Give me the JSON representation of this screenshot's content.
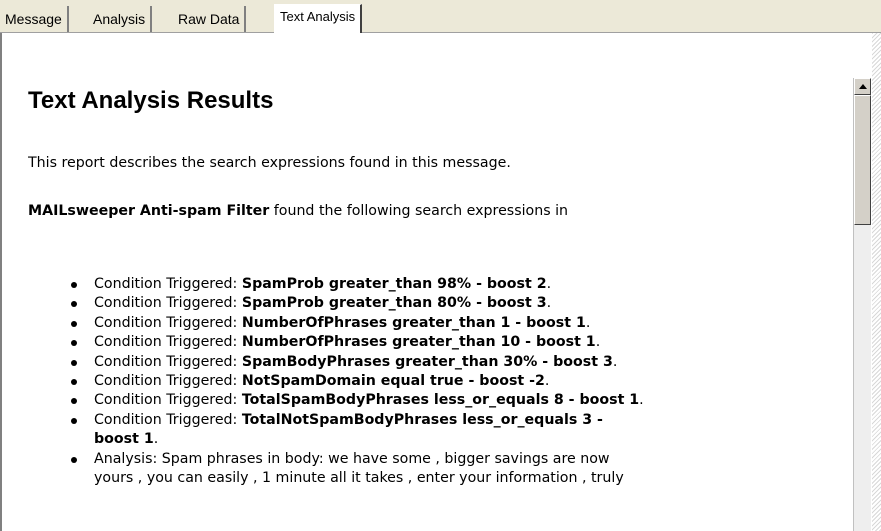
{
  "tabs": [
    {
      "label": "Message",
      "active": false
    },
    {
      "label": "Analysis",
      "active": false
    },
    {
      "label": "Raw Data",
      "active": false
    },
    {
      "label": "Text Analysis",
      "active": true
    }
  ],
  "report": {
    "title": "Text Analysis Results",
    "intro": "This report describes the search expressions found in this message.",
    "filter_name": "MAILsweeper Anti-spam Filter",
    "found_text": " found the following search expressions in",
    "items": [
      {
        "label": "Condition Triggered: ",
        "expression": "SpamProb greater_than 98% - boost 2",
        "end": "."
      },
      {
        "label": "Condition Triggered: ",
        "expression": "SpamProb greater_than 80% - boost 3",
        "end": "."
      },
      {
        "label": "Condition Triggered: ",
        "expression": "NumberOfPhrases greater_than 1 - boost 1",
        "end": "."
      },
      {
        "label": "Condition Triggered: ",
        "expression": "NumberOfPhrases greater_than 10 - boost 1",
        "end": "."
      },
      {
        "label": "Condition Triggered: ",
        "expression": "SpamBodyPhrases greater_than 30% - boost 3",
        "end": "."
      },
      {
        "label": "Condition Triggered: ",
        "expression": "NotSpamDomain equal true - boost -2",
        "end": "."
      },
      {
        "label": "Condition Triggered: ",
        "expression": "TotalSpamBodyPhrases less_or_equals 8 - boost 1",
        "end": "."
      },
      {
        "label": "Condition Triggered: ",
        "expression": "TotalNotSpamBodyPhrases less_or_equals 3 -",
        "expression_cont": "boost 1",
        "end": "."
      },
      {
        "label": "Analysis: Spam phrases in body: we have some , bigger savings are now",
        "label_cont": "yours , you can easily , 1 minute all it takes , enter your information , truly"
      }
    ]
  }
}
